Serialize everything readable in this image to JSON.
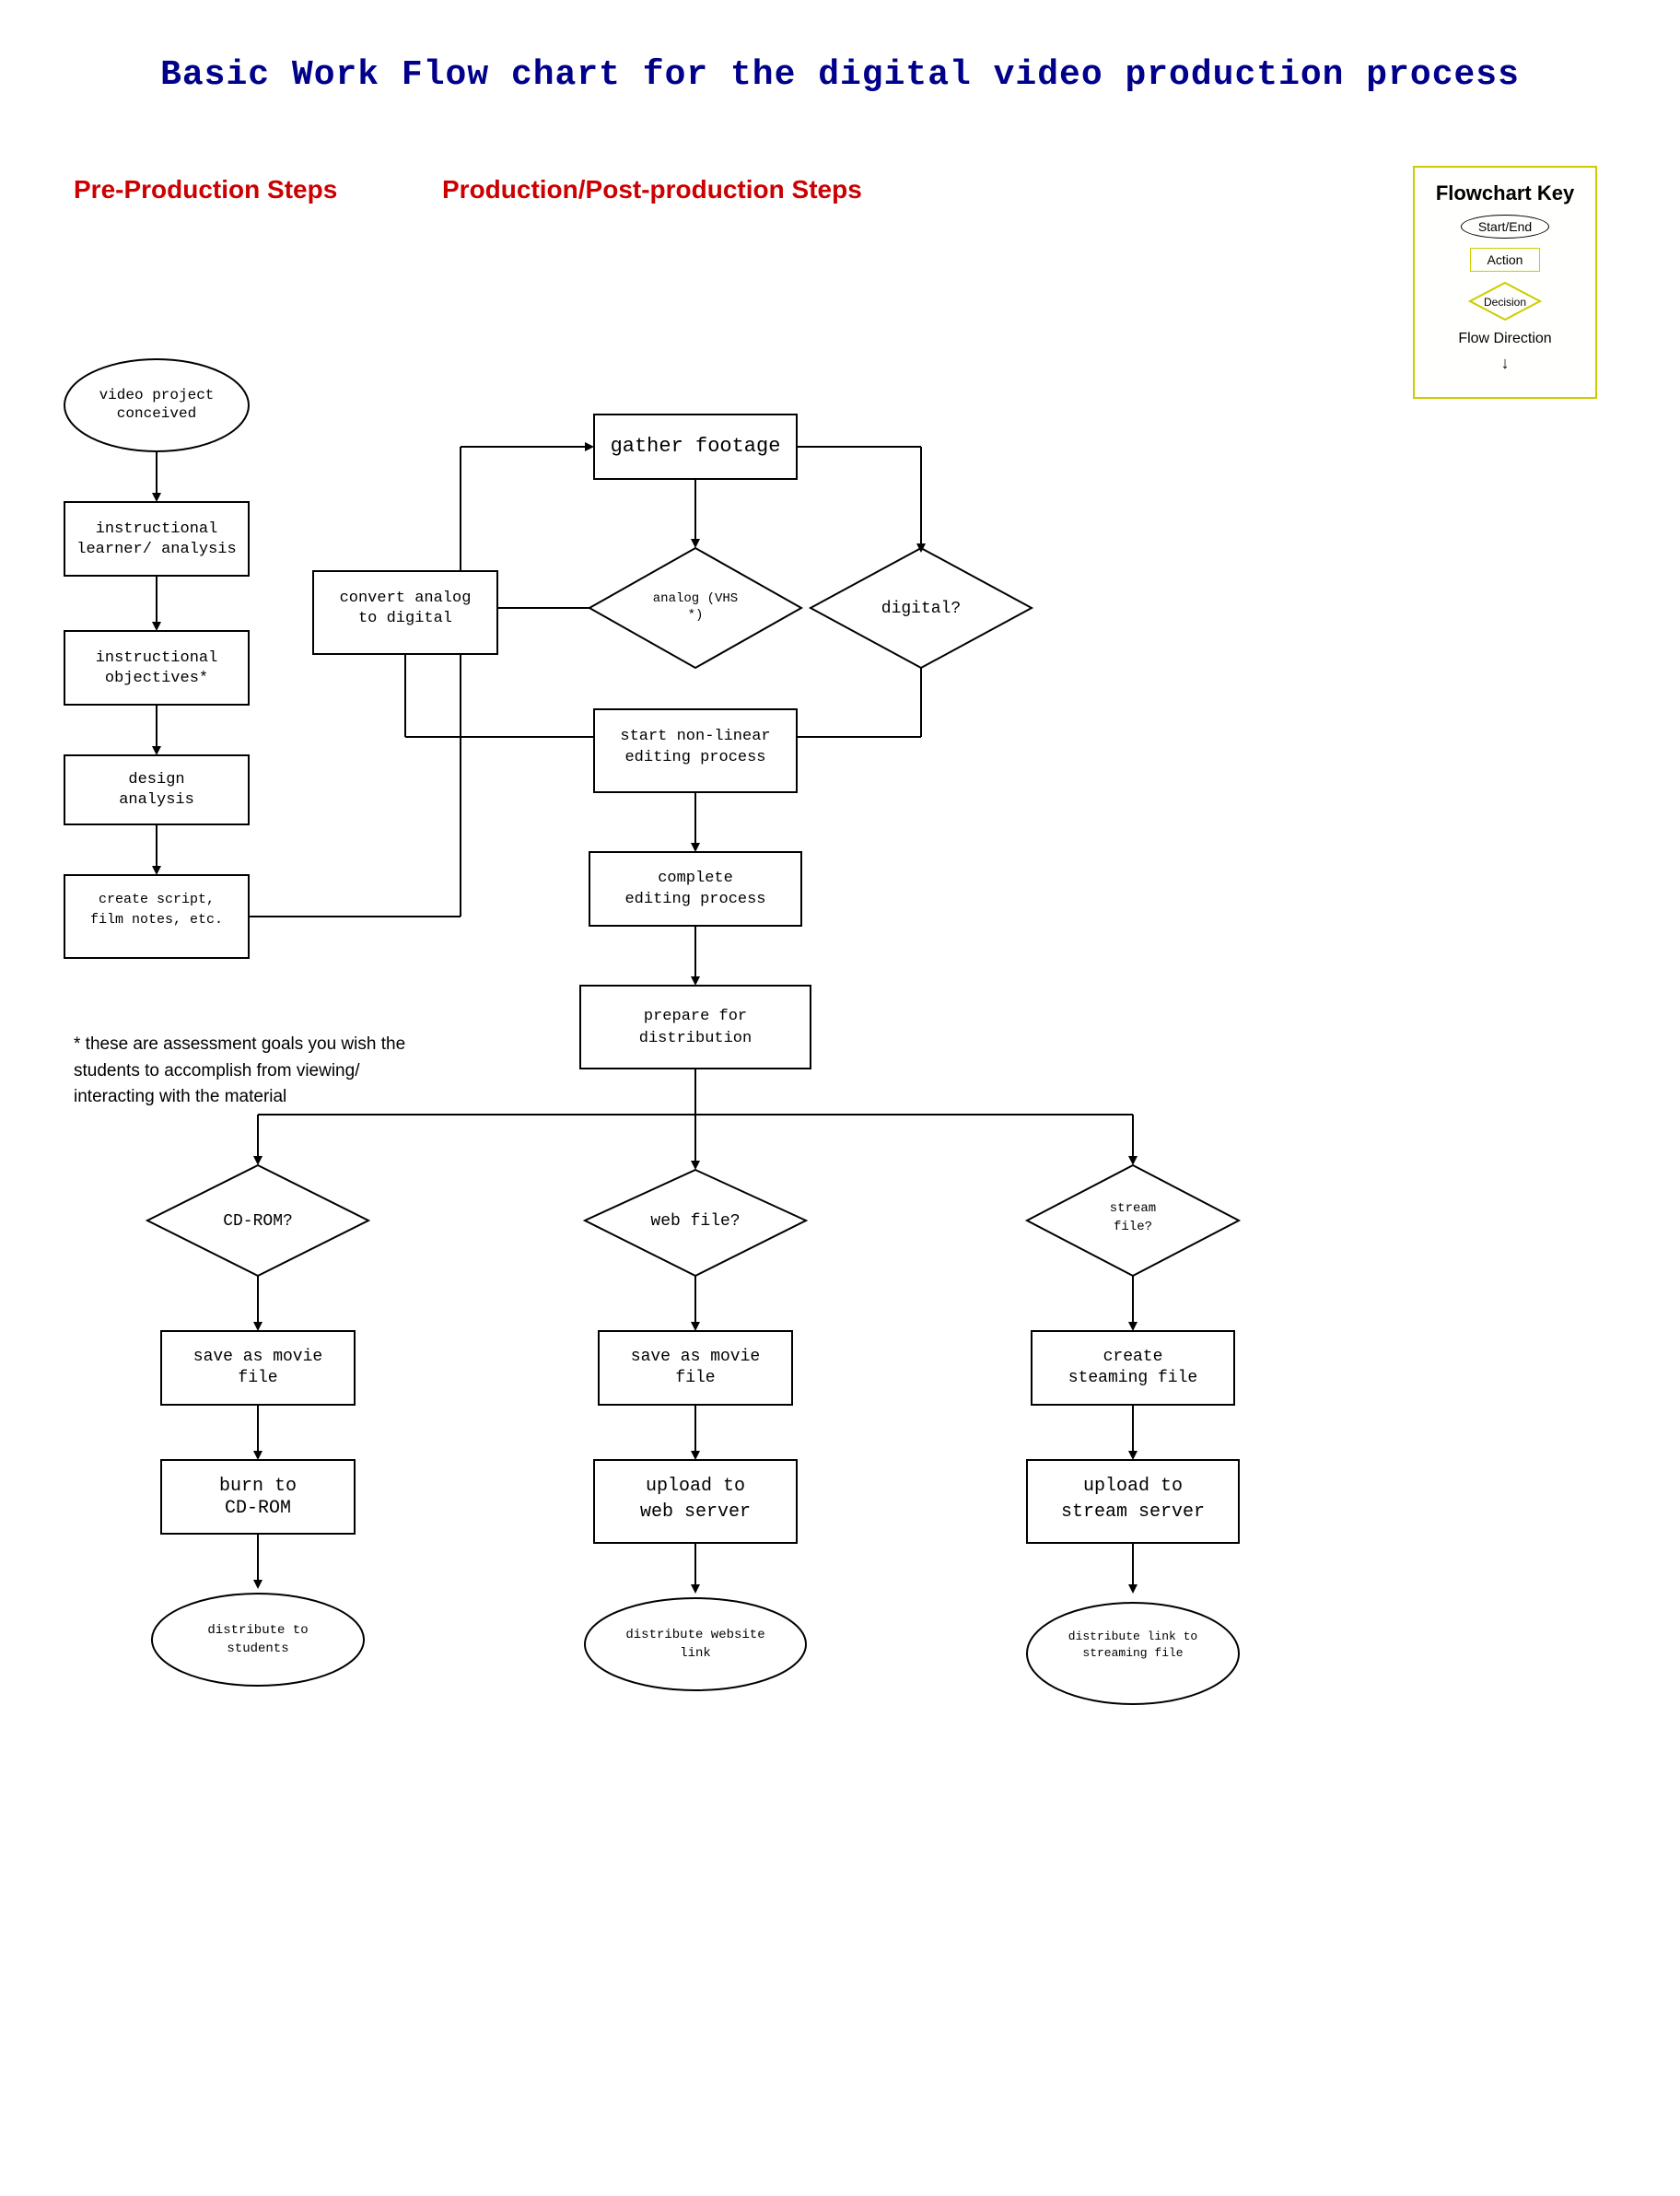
{
  "title": "Basic Work Flow chart for the digital video production process",
  "headers": {
    "preProduction": "Pre-Production Steps",
    "production": "Production/Post-production Steps"
  },
  "key": {
    "title": "Flowchart Key",
    "startEnd": "Start/End",
    "action": "Action",
    "decision": "Decision",
    "flowDirection": "Flow Direction"
  },
  "preProduction": {
    "nodes": [
      "video project conceived",
      "instructional learner/ analysis",
      "instructional objectives*",
      "design analysis",
      "create script, film notes, etc."
    ]
  },
  "production": {
    "nodes": [
      "gather footage",
      "analog (VHS*)",
      "digital?",
      "convert analog to digital",
      "start non-linear editing process",
      "complete editing process",
      "prepare for distribution"
    ]
  },
  "distribution": {
    "cdrom": {
      "decision": "CD-ROM?",
      "step1": "save as movie file",
      "step2": "burn to CD-ROM",
      "end": "distribute to students"
    },
    "web": {
      "decision": "web file?",
      "step1": "save as movie file",
      "step2": "upload to web server",
      "end": "distribute website link"
    },
    "stream": {
      "decision": "stream file?",
      "step1": "create steaming file",
      "step2": "upload to stream server",
      "end": "distribute link to streaming file"
    }
  },
  "footnote": "* these are assessment goals you wish the students to accomplish from viewing/ interacting with the material"
}
